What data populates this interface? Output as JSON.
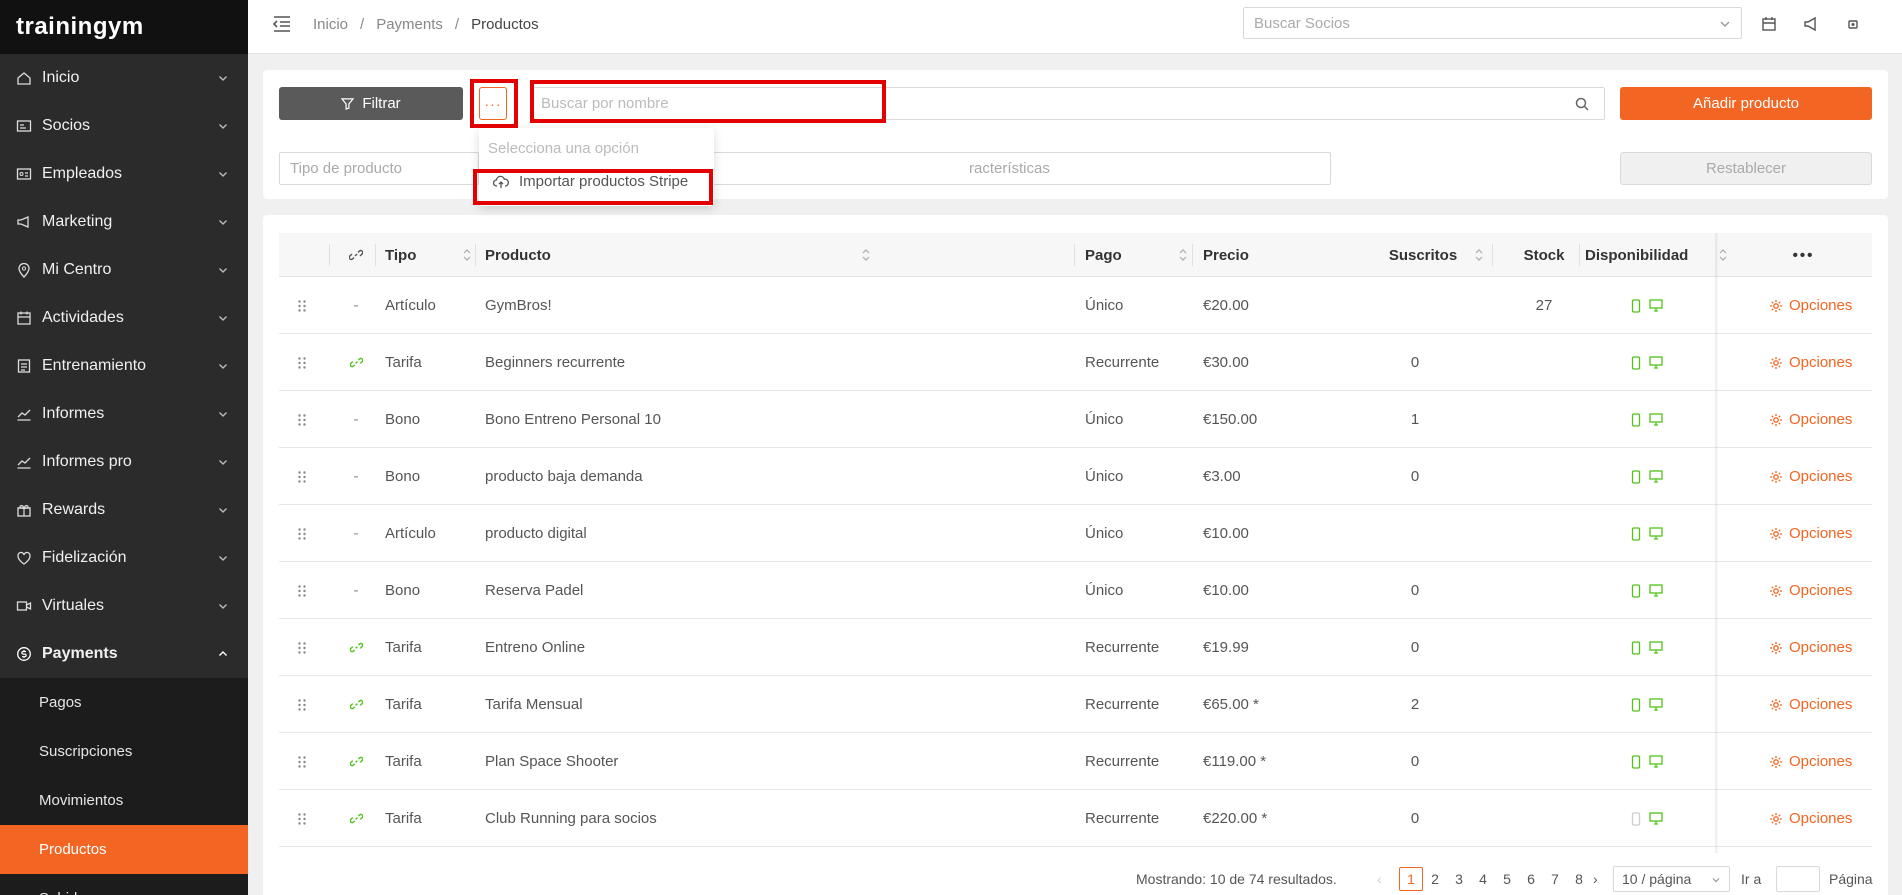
{
  "sidebar": {
    "logo": "trainingym",
    "items": [
      {
        "label": "Inicio",
        "icon": "home-icon"
      },
      {
        "label": "Socios",
        "icon": "id-card-icon"
      },
      {
        "label": "Empleados",
        "icon": "badge-icon"
      },
      {
        "label": "Marketing",
        "icon": "megaphone-icon"
      },
      {
        "label": "Mi Centro",
        "icon": "location-pin-icon"
      },
      {
        "label": "Actividades",
        "icon": "calendar-icon"
      },
      {
        "label": "Entrenamiento",
        "icon": "clipboard-icon"
      },
      {
        "label": "Informes",
        "icon": "line-chart-icon"
      },
      {
        "label": "Informes pro",
        "icon": "line-chart-icon"
      },
      {
        "label": "Rewards",
        "icon": "gift-icon"
      },
      {
        "label": "Fidelización",
        "icon": "heart-icon"
      },
      {
        "label": "Virtuales",
        "icon": "video-icon"
      },
      {
        "label": "Payments",
        "icon": "dollar-circle-icon"
      }
    ],
    "payments_sub": [
      "Pagos",
      "Suscripciones",
      "Movimientos",
      "Productos",
      "Subidas"
    ]
  },
  "topbar": {
    "breadcrumb": [
      "Inicio",
      "/",
      "Payments",
      "/",
      "Productos"
    ],
    "search_placeholder": "Buscar Socios"
  },
  "filters": {
    "filter_label": "Filtrar",
    "dots_label": "···",
    "search_placeholder": "Buscar por nombre",
    "add_label": "Añadir producto",
    "tipo_placeholder": "Tipo de producto",
    "carac_placeholder": "racterísticas",
    "reset_label": "Restablecer"
  },
  "dropdown": {
    "header": "Selecciona una opción",
    "item": "Importar productos Stripe"
  },
  "table": {
    "headers": {
      "tipo": "Tipo",
      "producto": "Producto",
      "pago": "Pago",
      "precio": "Precio",
      "suscritos": "Suscritos",
      "stock": "Stock",
      "disponibilidad": "Disponibilidad",
      "more": "•••"
    },
    "option_label": "Opciones",
    "rows": [
      {
        "link": "-",
        "tipo": "Artículo",
        "producto": "GymBros!",
        "pago": "Único",
        "precio": "€20.00",
        "suscritos": "",
        "stock": "27",
        "mobile": true
      },
      {
        "link": "link",
        "tipo": "Tarifa",
        "producto": "Beginners recurrente",
        "pago": "Recurrente",
        "precio": "€30.00",
        "suscritos": "0",
        "stock": "",
        "mobile": true
      },
      {
        "link": "-",
        "tipo": "Bono",
        "producto": "Bono Entreno Personal 10",
        "pago": "Único",
        "precio": "€150.00",
        "suscritos": "1",
        "stock": "",
        "mobile": true
      },
      {
        "link": "-",
        "tipo": "Bono",
        "producto": "producto baja demanda",
        "pago": "Único",
        "precio": "€3.00",
        "suscritos": "0",
        "stock": "",
        "mobile": true
      },
      {
        "link": "-",
        "tipo": "Artículo",
        "producto": "producto digital",
        "pago": "Único",
        "precio": "€10.00",
        "suscritos": "",
        "stock": "",
        "mobile": true
      },
      {
        "link": "-",
        "tipo": "Bono",
        "producto": "Reserva Padel",
        "pago": "Único",
        "precio": "€10.00",
        "suscritos": "0",
        "stock": "",
        "mobile": true
      },
      {
        "link": "link",
        "tipo": "Tarifa",
        "producto": "Entreno Online",
        "pago": "Recurrente",
        "precio": "€19.99",
        "suscritos": "0",
        "stock": "",
        "mobile": true
      },
      {
        "link": "link",
        "tipo": "Tarifa",
        "producto": "Tarifa Mensual",
        "pago": "Recurrente",
        "precio": "€65.00 *",
        "suscritos": "2",
        "stock": "",
        "mobile": true
      },
      {
        "link": "link",
        "tipo": "Tarifa",
        "producto": "Plan Space Shooter",
        "pago": "Recurrente",
        "precio": "€119.00 *",
        "suscritos": "0",
        "stock": "",
        "mobile": true
      },
      {
        "link": "link",
        "tipo": "Tarifa",
        "producto": "Club Running para socios",
        "pago": "Recurrente",
        "precio": "€220.00 *",
        "suscritos": "0",
        "stock": "",
        "mobile": false
      }
    ]
  },
  "pagination": {
    "summary": "Mostrando: 10 de 74 resultados.",
    "pages": [
      "1",
      "2",
      "3",
      "4",
      "5",
      "6",
      "7",
      "8"
    ],
    "current": "1",
    "page_size": "10 / página",
    "goto_label": "Ir a",
    "page_label": "Página"
  },
  "colors": {
    "accent": "#f26522",
    "sidebar": "#2b2b2b",
    "green": "#52c41a",
    "highlight": "#e30000"
  }
}
